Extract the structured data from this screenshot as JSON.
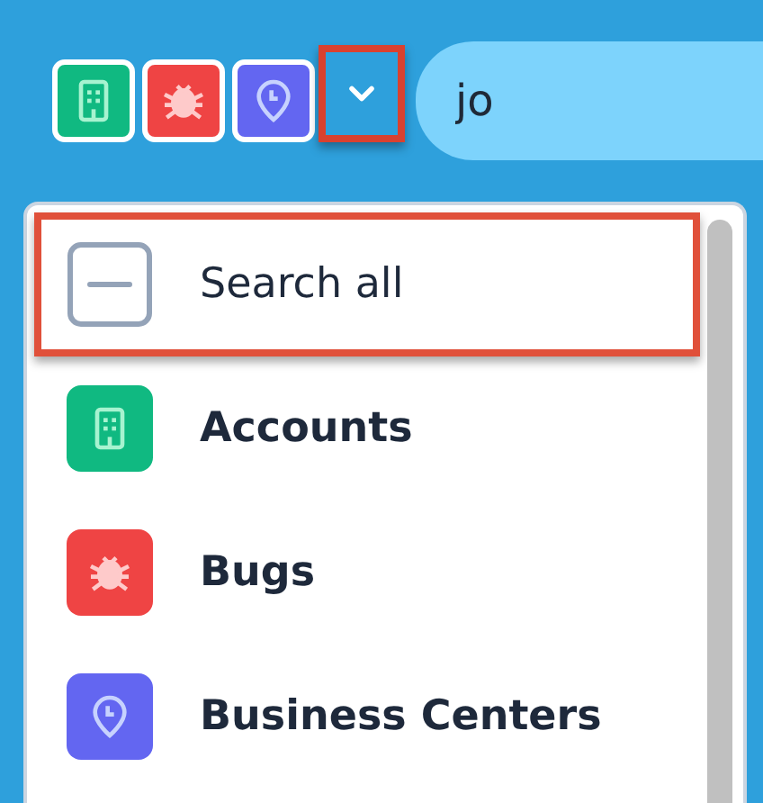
{
  "header": {
    "module_chips": [
      {
        "kind": "building",
        "color": "#10b981"
      },
      {
        "kind": "bug",
        "color": "#ef4444"
      },
      {
        "kind": "pin",
        "color": "#6366f1"
      }
    ],
    "dropdown_toggle": {
      "highlighted": true
    },
    "search": {
      "value": "jo"
    }
  },
  "dropdown": {
    "items": [
      {
        "kind": "all",
        "label": "Search all",
        "highlighted": true
      },
      {
        "kind": "building",
        "color": "#10b981",
        "label": "Accounts",
        "highlighted": false
      },
      {
        "kind": "bug",
        "color": "#ef4444",
        "label": "Bugs",
        "highlighted": false
      },
      {
        "kind": "pin",
        "color": "#6366f1",
        "label": "Business Centers",
        "highlighted": false
      }
    ]
  }
}
